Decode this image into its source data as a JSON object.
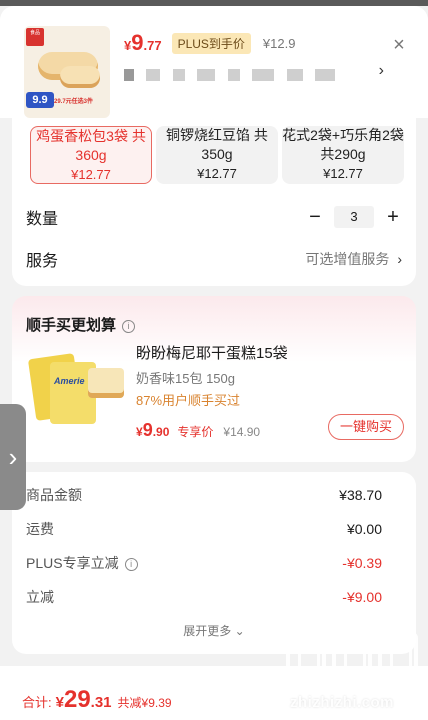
{
  "header": {
    "thumbnail": {
      "badge_price": "9.9",
      "promo_text": "29.7元任选3件",
      "brand": "食品"
    },
    "price": {
      "currency": "¥",
      "integer": "9",
      "decimal": ".77"
    },
    "plus_tag": "PLUS到手价",
    "original_price": "¥12.9",
    "selected_spec_text": "",
    "close_icon": "close-icon"
  },
  "options": [
    {
      "name": "鸡蛋香松包3袋 共360g",
      "price": "¥12.77",
      "selected": true
    },
    {
      "name": "铜锣烧红豆馅 共350g",
      "price": "¥12.77",
      "selected": false
    },
    {
      "name": "花式2袋+巧乐角2袋 共290g",
      "price": "¥12.77",
      "selected": false
    }
  ],
  "quantity": {
    "label": "数量",
    "minus": "−",
    "value": "3",
    "plus": "+"
  },
  "service": {
    "label": "服务",
    "value": "可选增值服务",
    "chevron": "›"
  },
  "bundle": {
    "title": "顺手买更划算",
    "info_icon": "i",
    "product": {
      "name": "盼盼梅尼耶干蛋糕15袋",
      "sub": "奶香味15包 150g",
      "stat": "87%用户顺手买过",
      "price_currency": "¥",
      "price_integer": "9",
      "price_decimal": ".90",
      "price_tag": "专享价",
      "old_price": "¥14.90",
      "pack_label": "Amerie"
    },
    "buy_button": "一键购买"
  },
  "summary": {
    "rows": [
      {
        "label": "商品金额",
        "value": "¥38.70",
        "red": false,
        "info": false
      },
      {
        "label": "运费",
        "value": "¥0.00",
        "red": false,
        "info": false
      },
      {
        "label": "PLUS专享立减",
        "value": "-¥0.39",
        "red": true,
        "info": true
      },
      {
        "label": "立减",
        "value": "-¥9.00",
        "red": true,
        "info": false
      }
    ],
    "more": "展开更多 ⌄"
  },
  "bottom": {
    "label": "合计:",
    "currency": "¥",
    "integer": "29",
    "decimal": ".31",
    "saved": "共减¥9.39"
  },
  "handle_icon": "›",
  "watermark": "zhizhizhi.com",
  "colors": {
    "accent": "#e5322d",
    "plus_bg": "#fbe7b6",
    "badge_blue": "#2f55c4"
  }
}
